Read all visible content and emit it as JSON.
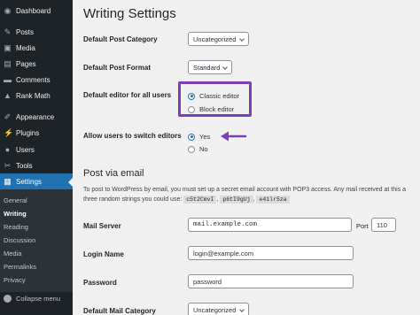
{
  "sidebar": {
    "items": [
      {
        "label": "Dashboard",
        "icon": "dashboard-icon",
        "glyph": "◉"
      },
      {
        "label": "Posts",
        "icon": "pin-icon",
        "glyph": "✎"
      },
      {
        "label": "Media",
        "icon": "media-icon",
        "glyph": "▣"
      },
      {
        "label": "Pages",
        "icon": "page-icon",
        "glyph": "▤"
      },
      {
        "label": "Comments",
        "icon": "comment-icon",
        "glyph": "▬"
      },
      {
        "label": "Rank Math",
        "icon": "rank-math-icon",
        "glyph": "▲"
      },
      {
        "label": "Appearance",
        "icon": "brush-icon",
        "glyph": "✐"
      },
      {
        "label": "Plugins",
        "icon": "plugin-icon",
        "glyph": "⚡"
      },
      {
        "label": "Users",
        "icon": "user-icon",
        "glyph": "●"
      },
      {
        "label": "Tools",
        "icon": "wrench-icon",
        "glyph": "✂"
      },
      {
        "label": "Settings",
        "icon": "settings-icon",
        "glyph": "▦"
      }
    ],
    "submenu": [
      "General",
      "Writing",
      "Reading",
      "Discussion",
      "Media",
      "Permalinks",
      "Privacy"
    ],
    "collapse_label": "Collapse menu"
  },
  "page": {
    "title": "Writing Settings",
    "default_category_label": "Default Post Category",
    "default_category_value": "Uncategorized",
    "default_format_label": "Default Post Format",
    "default_format_value": "Standard",
    "editor_label": "Default editor for all users",
    "editor_options": [
      "Classic editor",
      "Block editor"
    ],
    "switch_label": "Allow users to switch editors",
    "switch_options": [
      "Yes",
      "No"
    ],
    "email_section_title": "Post via email",
    "email_desc_1": "To post to WordPress by email, you must set up a secret email account with POP3 access. Any mail received at this a",
    "email_desc_2": "three random strings you could use:",
    "random_strings": [
      "c5t2CmvI",
      "p6tI9gUj",
      "e41lr5za"
    ],
    "mail_server_label": "Mail Server",
    "mail_server_value": "mail.example.com",
    "port_label": "Port",
    "port_value": "110",
    "login_label": "Login Name",
    "login_value": "login@example.com",
    "password_label": "Password",
    "password_value": "password",
    "mail_category_label": "Default Mail Category",
    "mail_category_value": "Uncategorized"
  },
  "colors": {
    "accent": "#2271b1",
    "highlight": "#7b3fb5",
    "sidebar_bg": "#1d2327"
  }
}
